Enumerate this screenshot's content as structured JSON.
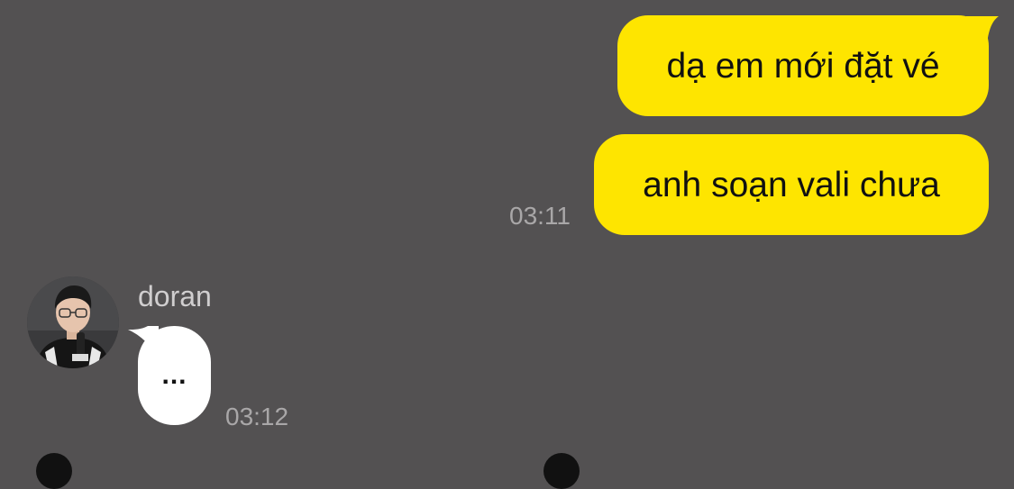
{
  "colors": {
    "background": "#535152",
    "outgoing_bubble": "#FEE500",
    "incoming_bubble": "#FFFFFF",
    "timestamp": "#A9A7A8",
    "sender_name": "#D0CECF"
  },
  "messages": {
    "outgoing": [
      {
        "text": "dạ em mới đặt vé"
      },
      {
        "text": "anh soạn vali chưa"
      }
    ],
    "outgoing_time": "03:11",
    "incoming": {
      "sender": "doran",
      "avatar_icon": "profile-photo",
      "text": "...",
      "time": "03:12"
    }
  }
}
